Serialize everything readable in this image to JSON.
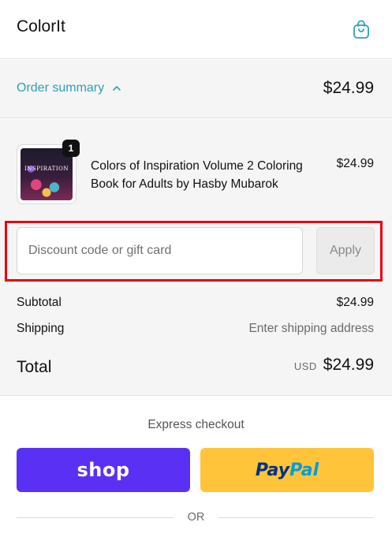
{
  "header": {
    "brand": "ColorIt",
    "cart_icon": "shopping-bag-icon"
  },
  "summary": {
    "toggle_label": "Order summary",
    "toggle_icon": "chevron-up-icon",
    "total": "$24.99"
  },
  "product": {
    "name": "Colors of Inspiration Volume 2 Coloring Book for Adults by Hasby Mubarok",
    "price": "$24.99",
    "quantity": "1",
    "thumbnail_text": "INSPIRATION"
  },
  "discount": {
    "placeholder": "Discount code or gift card",
    "value": "",
    "apply_label": "Apply"
  },
  "totals": {
    "subtotal_label": "Subtotal",
    "subtotal_value": "$24.99",
    "shipping_label": "Shipping",
    "shipping_value": "Enter shipping address",
    "total_label": "Total",
    "currency": "USD",
    "total_value": "$24.99"
  },
  "express": {
    "title": "Express checkout",
    "shop_label": "shop",
    "paypal_part1": "Pay",
    "paypal_part2": "Pal",
    "or_label": "OR"
  },
  "colors": {
    "accent": "#2f9fb4",
    "shop_purple": "#5a31f4",
    "paypal_yellow": "#ffc439",
    "highlight_red": "#e8000b"
  }
}
